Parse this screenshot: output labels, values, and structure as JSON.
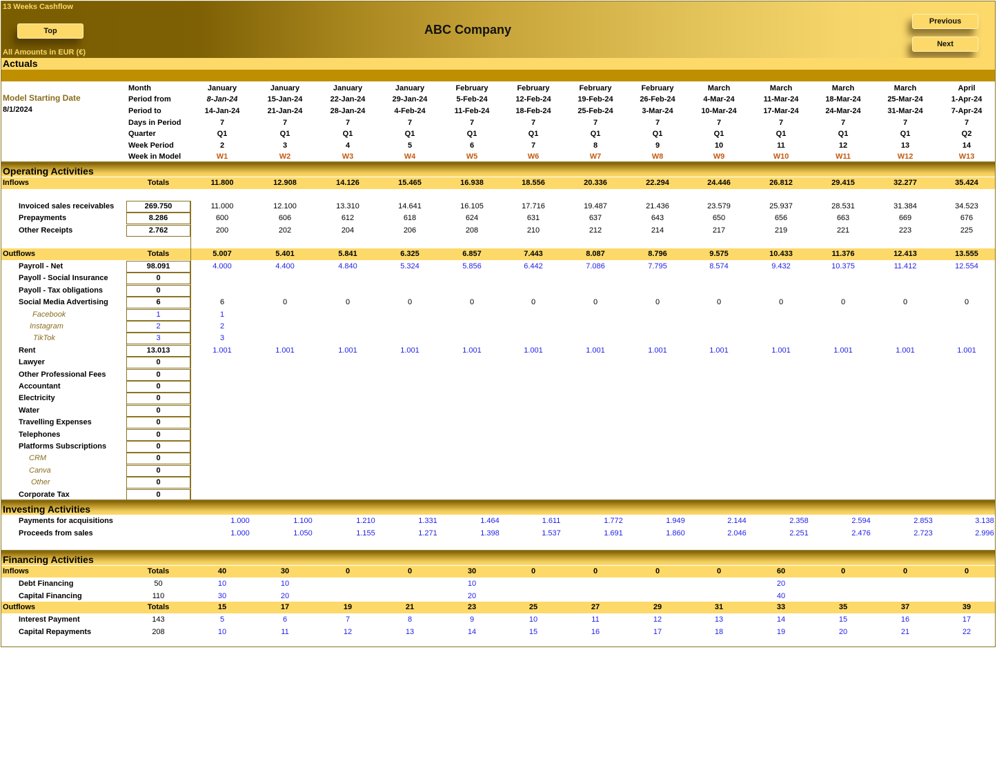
{
  "header": {
    "app_title": "13 Weeks Cashflow",
    "company": "ABC Company",
    "amounts_note": "All Amounts in  EUR (€)",
    "section_label": "Actuals",
    "buttons": {
      "top": "Top",
      "previous": "Previous",
      "next": "Next"
    }
  },
  "model": {
    "starting_date_label": "Model Starting Date",
    "starting_date": "8/1/2024"
  },
  "period_header": {
    "labels": {
      "month": "Month",
      "period_from": "Period from",
      "period_to": "Period to",
      "days": "Days in Period",
      "quarter": "Quarter",
      "week_period": "Week Period",
      "week_in_model": "Week in Model"
    },
    "month": [
      "January",
      "January",
      "January",
      "January",
      "February",
      "February",
      "February",
      "February",
      "March",
      "March",
      "March",
      "March",
      "April"
    ],
    "period_from": [
      "8-Jan-24",
      "15-Jan-24",
      "22-Jan-24",
      "29-Jan-24",
      "5-Feb-24",
      "12-Feb-24",
      "19-Feb-24",
      "26-Feb-24",
      "4-Mar-24",
      "11-Mar-24",
      "18-Mar-24",
      "25-Mar-24",
      "1-Apr-24"
    ],
    "period_to": [
      "14-Jan-24",
      "21-Jan-24",
      "28-Jan-24",
      "4-Feb-24",
      "11-Feb-24",
      "18-Feb-24",
      "25-Feb-24",
      "3-Mar-24",
      "10-Mar-24",
      "17-Mar-24",
      "24-Mar-24",
      "31-Mar-24",
      "7-Apr-24"
    ],
    "days": [
      "7",
      "7",
      "7",
      "7",
      "7",
      "7",
      "7",
      "7",
      "7",
      "7",
      "7",
      "7",
      "7"
    ],
    "quarter": [
      "Q1",
      "Q1",
      "Q1",
      "Q1",
      "Q1",
      "Q1",
      "Q1",
      "Q1",
      "Q1",
      "Q1",
      "Q1",
      "Q1",
      "Q2"
    ],
    "week_period": [
      "2",
      "3",
      "4",
      "5",
      "6",
      "7",
      "8",
      "9",
      "10",
      "11",
      "12",
      "13",
      "14"
    ],
    "week_in_model": [
      "W1",
      "W2",
      "W3",
      "W4",
      "W5",
      "W6",
      "W7",
      "W8",
      "W9",
      "W10",
      "W11",
      "W12",
      "W13"
    ]
  },
  "operating": {
    "title": "Operating Activities",
    "inflows": {
      "label": "Inflows",
      "totals_label": "Totals",
      "values": [
        "11.800",
        "12.908",
        "14.126",
        "15.465",
        "16.938",
        "18.556",
        "20.336",
        "22.294",
        "24.446",
        "26.812",
        "29.415",
        "32.277",
        "35.424"
      ],
      "rows": [
        {
          "label": "Invoiced sales receivables",
          "total": "269.750",
          "style": "dark",
          "values": [
            "11.000",
            "12.100",
            "13.310",
            "14.641",
            "16.105",
            "17.716",
            "19.487",
            "21.436",
            "23.579",
            "25.937",
            "28.531",
            "31.384",
            "34.523"
          ]
        },
        {
          "label": "Prepayments",
          "total": "8.286",
          "style": "dark",
          "values": [
            "600",
            "606",
            "612",
            "618",
            "624",
            "631",
            "637",
            "643",
            "650",
            "656",
            "663",
            "669",
            "676"
          ]
        },
        {
          "label": "Other Receipts",
          "total": "2.762",
          "style": "dark",
          "values": [
            "200",
            "202",
            "204",
            "206",
            "208",
            "210",
            "212",
            "214",
            "217",
            "219",
            "221",
            "223",
            "225"
          ]
        }
      ]
    },
    "outflows": {
      "label": "Outflows",
      "totals_label": "Totals",
      "values": [
        "5.007",
        "5.401",
        "5.841",
        "6.325",
        "6.857",
        "7.443",
        "8.087",
        "8.796",
        "9.575",
        "10.433",
        "11.376",
        "12.413",
        "13.555"
      ],
      "rows": [
        {
          "label": "Payroll - Net",
          "total": "98.091",
          "style": "blue",
          "values": [
            "4.000",
            "4.400",
            "4.840",
            "5.324",
            "5.856",
            "6.442",
            "7.086",
            "7.795",
            "8.574",
            "9.432",
            "10.375",
            "11.412",
            "12.554"
          ]
        },
        {
          "label": "Payoll - Social Insurance",
          "total": "0",
          "style": "blue",
          "values": []
        },
        {
          "label": "Payoll - Tax obligations",
          "total": "0",
          "style": "blue",
          "values": []
        },
        {
          "label": "Social Media Advertising",
          "total": "6",
          "style": "dark-normal",
          "values": [
            "6",
            "0",
            "0",
            "0",
            "0",
            "0",
            "0",
            "0",
            "0",
            "0",
            "0",
            "0",
            "0"
          ]
        },
        {
          "label": "Facebook",
          "total": "1",
          "style": "blue",
          "sub": true,
          "total_blue": true,
          "values": [
            "1"
          ]
        },
        {
          "label": "Instagram",
          "total": "2",
          "style": "blue",
          "sub": true,
          "total_blue": true,
          "values": [
            "2"
          ]
        },
        {
          "label": "TikTok",
          "total": "3",
          "style": "blue",
          "sub": true,
          "total_blue": true,
          "values": [
            "3"
          ]
        },
        {
          "label": "Rent",
          "total": "13.013",
          "style": "blue",
          "values": [
            "1.001",
            "1.001",
            "1.001",
            "1.001",
            "1.001",
            "1.001",
            "1.001",
            "1.001",
            "1.001",
            "1.001",
            "1.001",
            "1.001",
            "1.001"
          ]
        },
        {
          "label": "Lawyer",
          "total": "0",
          "style": "blue",
          "values": []
        },
        {
          "label": "Other Professional Fees",
          "total": "0",
          "style": "blue",
          "values": []
        },
        {
          "label": "Accountant",
          "total": "0",
          "style": "blue",
          "values": []
        },
        {
          "label": "Electricity",
          "total": "0",
          "style": "blue",
          "values": []
        },
        {
          "label": "Water",
          "total": "0",
          "style": "blue",
          "values": []
        },
        {
          "label": "Travelling Expenses",
          "total": "0",
          "style": "blue",
          "values": []
        },
        {
          "label": "Telephones",
          "total": "0",
          "style": "blue",
          "values": []
        },
        {
          "label": "Platforms Subscriptions",
          "total": "0",
          "style": "blue",
          "values": []
        },
        {
          "label": "CRM",
          "total": "0",
          "style": "blue",
          "sub": true,
          "values": []
        },
        {
          "label": "Canva",
          "total": "0",
          "style": "blue",
          "sub": true,
          "values": []
        },
        {
          "label": "Other",
          "total": "0",
          "style": "blue",
          "sub": true,
          "values": []
        },
        {
          "label": "Corporate Tax",
          "total": "0",
          "style": "blue",
          "values": []
        }
      ]
    }
  },
  "investing": {
    "title": "Investing Activities",
    "rows": [
      {
        "label": "Payments for acquisitions",
        "values": [
          "1.000",
          "1.100",
          "1.210",
          "1.331",
          "1.464",
          "1.611",
          "1.772",
          "1.949",
          "2.144",
          "2.358",
          "2.594",
          "2.853",
          "3.138"
        ]
      },
      {
        "label": "Proceeds from sales",
        "values": [
          "1.000",
          "1.050",
          "1.155",
          "1.271",
          "1.398",
          "1.537",
          "1.691",
          "1.860",
          "2.046",
          "2.251",
          "2.476",
          "2.723",
          "2.996"
        ]
      }
    ]
  },
  "financing": {
    "title": "Financing Activities",
    "inflows": {
      "label": "Inflows",
      "totals_label": "Totals",
      "values": [
        "40",
        "30",
        "0",
        "0",
        "30",
        "0",
        "0",
        "0",
        "0",
        "60",
        "0",
        "0",
        "0"
      ],
      "rows": [
        {
          "label": "Debt Financing",
          "total": "50",
          "values": [
            "10",
            "10",
            "",
            "",
            "10",
            "",
            "",
            "",
            "",
            "20",
            "",
            "",
            ""
          ]
        },
        {
          "label": "Capital Financing",
          "total": "110",
          "values": [
            "30",
            "20",
            "",
            "",
            "20",
            "",
            "",
            "",
            "",
            "40",
            "",
            "",
            ""
          ]
        }
      ]
    },
    "outflows": {
      "label": "Outflows",
      "totals_label": "Totals",
      "values": [
        "15",
        "17",
        "19",
        "21",
        "23",
        "25",
        "27",
        "29",
        "31",
        "33",
        "35",
        "37",
        "39"
      ],
      "rows": [
        {
          "label": "Interest Payment",
          "total": "143",
          "values": [
            "5",
            "6",
            "7",
            "8",
            "9",
            "10",
            "11",
            "12",
            "13",
            "14",
            "15",
            "16",
            "17"
          ]
        },
        {
          "label": "Capital Repayments",
          "total": "208",
          "values": [
            "10",
            "11",
            "12",
            "13",
            "14",
            "15",
            "16",
            "17",
            "18",
            "19",
            "20",
            "21",
            "22"
          ]
        }
      ]
    }
  },
  "colors": {
    "gold_light": "#fdd96a",
    "gold_dark": "#bf8f00",
    "brown": "#7f6000",
    "input_blue": "#1f1fe6",
    "week_orange": "#c55a11",
    "sub_label_gold": "#8a6d1e"
  }
}
